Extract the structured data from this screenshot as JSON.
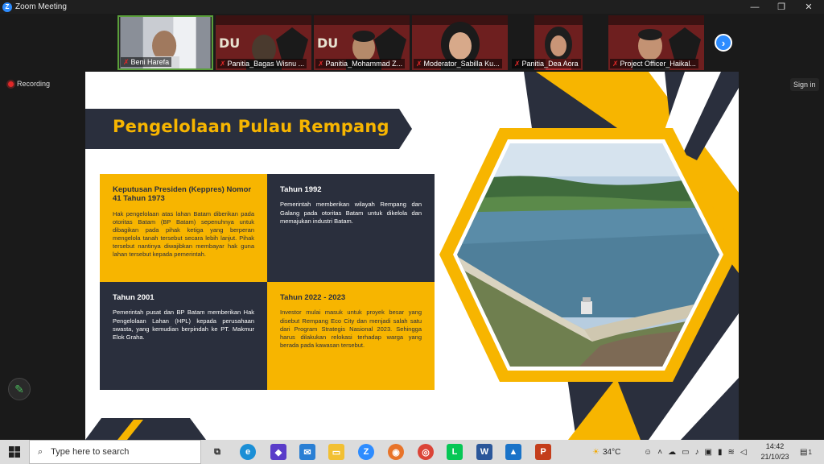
{
  "window": {
    "title": "Zoom Meeting",
    "controls": [
      "minimize",
      "restore",
      "close"
    ]
  },
  "participants": [
    {
      "name": "Beni Harefa",
      "muted": true,
      "active": true
    },
    {
      "name": "Panitia_Bagas Wisnu ...",
      "muted": true
    },
    {
      "name": "Panitia_Mohammad Z...",
      "muted": true
    },
    {
      "name": "Moderator_Sabilla Ku...",
      "muted": true
    },
    {
      "name": "Panitia_Dea Aora",
      "muted": true
    },
    {
      "name": "Project Officer_Haikal...",
      "muted": true
    }
  ],
  "zoom_ui": {
    "recording_label": "Recording",
    "signin_label": "Sign in"
  },
  "slide": {
    "title": "Pengelolaan Pulau Rempang",
    "cells": [
      {
        "heading": "Keputusan Presiden (Keppres) Nomor 41 Tahun 1973",
        "body": "Hak pengelolaan atas lahan Batam diberikan pada otoritas Batam (BP Batam) sepenuhnya untuk dibagikan pada pihak ketiga yang berperan mengelola tanah tersebut secara lebih lanjut. Pihak tersebut nantinya diwajibkan membayar hak guna lahan tersebut kepada pemerintah."
      },
      {
        "heading": "Tahun 1992",
        "body": "Pemerintah memberikan wilayah Rempang dan Galang pada otoritas Batam untuk dikelola dan memajukan industri Batam."
      },
      {
        "heading": "Tahun 2001",
        "body": "Pemerintah pusat dan BP Batam memberikan Hak Pengelolaan Lahan (HPL) kepada perusahaan swasta, yang kemudian berpindah ke PT. Makmur Elok Graha."
      },
      {
        "heading": "Tahun 2022 - 2023",
        "body": "Investor mulai masuk untuk proyek besar yang disebut Rempang Eco City dan menjadi salah satu dari Program Strategis Nasional 2023. Sehingga harus dilakukan relokasi terhadap warga yang berada pada kawasan tersebut."
      }
    ],
    "colors": {
      "accent": "#f7b500",
      "dark": "#2a2f3d"
    }
  },
  "taskbar": {
    "search_placeholder": "Type here to search",
    "apps": [
      "task-view",
      "edge",
      "code-editor",
      "mail",
      "file-explorer",
      "zoom",
      "firefox",
      "chrome",
      "line",
      "word",
      "photos",
      "powerpoint"
    ],
    "weather": "34°C",
    "time": "14:42",
    "date": "21/10/23",
    "notification_count": "1"
  }
}
